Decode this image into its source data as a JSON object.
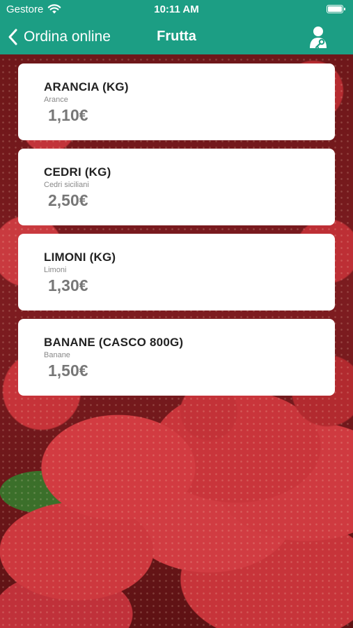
{
  "status_bar": {
    "carrier": "Gestore",
    "time": "10:11 AM",
    "wifi_icon": "wifi-icon",
    "battery_icon": "battery-icon"
  },
  "nav": {
    "back_label": "Ordina online",
    "title": "Frutta",
    "back_icon": "chevron-left-icon",
    "user_icon": "user-key-icon",
    "bar_color": "#1c9e84"
  },
  "products": [
    {
      "name": "ARANCIA (KG)",
      "description": "Arance",
      "price": "1,10€"
    },
    {
      "name": "CEDRI (KG)",
      "description": "Cedri siciliani",
      "price": "2,50€"
    },
    {
      "name": "LIMONI (KG)",
      "description": "Limoni",
      "price": "1,30€"
    },
    {
      "name": "BANANE (CASCO 800G)",
      "description": "Banane",
      "price": "1,50€"
    }
  ]
}
